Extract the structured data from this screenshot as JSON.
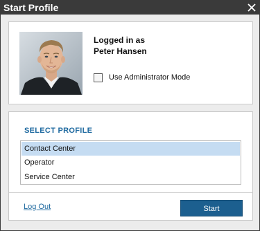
{
  "window": {
    "title": "Start Profile",
    "close_icon": "close-icon"
  },
  "user": {
    "logged_in_label": "Logged in as",
    "name": "Peter Hansen",
    "admin_mode_label": "Use Administrator Mode",
    "admin_mode_checked": false,
    "avatar_icon": "user-photo"
  },
  "profile": {
    "section_title": "SELECT PROFILE",
    "items": [
      {
        "label": "Contact Center",
        "selected": true
      },
      {
        "label": "Operator",
        "selected": false
      },
      {
        "label": "Service Center",
        "selected": false
      }
    ]
  },
  "actions": {
    "logout_label": "Log Out",
    "start_label": "Start"
  },
  "colors": {
    "titlebar": "#3a3a3a",
    "accent_link": "#1f6aa0",
    "button": "#1c5f8f",
    "selection": "#c5dcf2"
  }
}
